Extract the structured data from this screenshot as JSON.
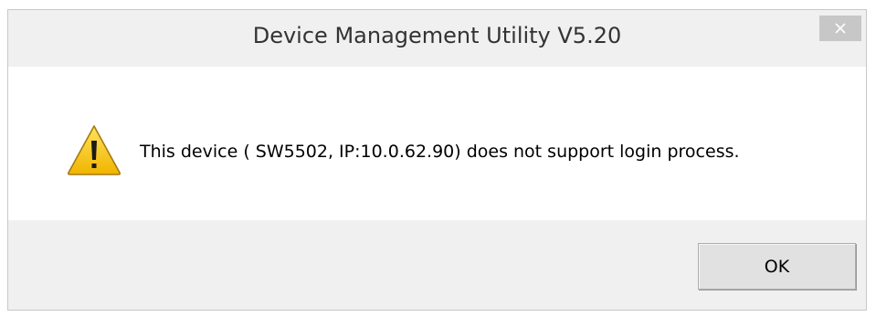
{
  "window": {
    "title": "Device Management Utility V5.20",
    "close_label": "✕"
  },
  "message": {
    "icon": "warning-icon",
    "text": "This device  ( SW5502,  IP:10.0.62.90) does not support login process."
  },
  "buttons": {
    "ok_label": "OK"
  },
  "colors": {
    "titlebar_bg": "#f0f0f0",
    "close_bg": "#c7c7c7",
    "content_bg": "#ffffff",
    "footer_bg": "#f0f0f0",
    "warning_yellow": "#f5c400"
  }
}
